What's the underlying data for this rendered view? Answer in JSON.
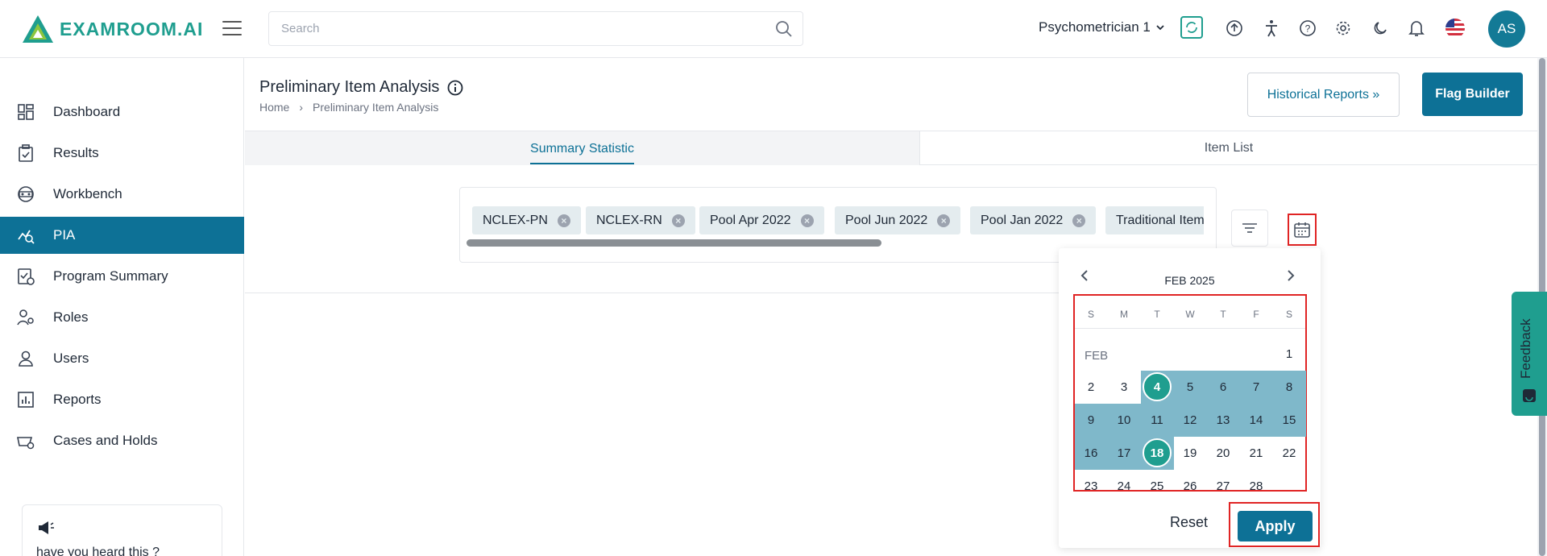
{
  "app": {
    "logo_text": "EXAMROOM.AI"
  },
  "search": {
    "placeholder": "Search"
  },
  "user": {
    "name": "Psychometrician 1",
    "initials": "AS"
  },
  "sidebar": {
    "items": [
      {
        "label": "Dashboard",
        "icon": "dashboard-icon"
      },
      {
        "label": "Results",
        "icon": "clipboard-check-icon"
      },
      {
        "label": "Workbench",
        "icon": "workbench-icon"
      },
      {
        "label": "PIA",
        "icon": "analytics-icon",
        "active": true
      },
      {
        "label": "Program Summary",
        "icon": "program-summary-icon"
      },
      {
        "label": "Roles",
        "icon": "roles-icon"
      },
      {
        "label": "Users",
        "icon": "user-icon"
      },
      {
        "label": "Reports",
        "icon": "reports-icon"
      },
      {
        "label": "Cases and Holds",
        "icon": "cases-icon"
      }
    ],
    "news": {
      "text": "have you heard this ?",
      "icon": "megaphone-icon"
    }
  },
  "page": {
    "title": "Preliminary Item Analysis",
    "breadcrumb": [
      "Home",
      "Preliminary Item Analysis"
    ],
    "historical_reports": "Historical Reports »",
    "flag_builder": "Flag Builder"
  },
  "tabs": [
    "Summary Statistic",
    "Item List"
  ],
  "chips": [
    "NCLEX-PN",
    "NCLEX-RN",
    "Pool Apr 2022",
    "Pool Jun 2022",
    "Pool Jan 2022",
    "Traditional Item"
  ],
  "calendar": {
    "month_title": "FEB 2025",
    "month_label": "FEB",
    "weekdays": [
      "S",
      "M",
      "T",
      "W",
      "T",
      "F",
      "S"
    ],
    "range_start": 4,
    "range_end": 18,
    "reset_label": "Reset",
    "apply_label": "Apply"
  },
  "feedback": {
    "label": "Feedback"
  },
  "colors": {
    "primary": "#0d7196",
    "accent": "#1f9e8f",
    "range": "#7fb8ca",
    "highlight": "#e02424"
  }
}
